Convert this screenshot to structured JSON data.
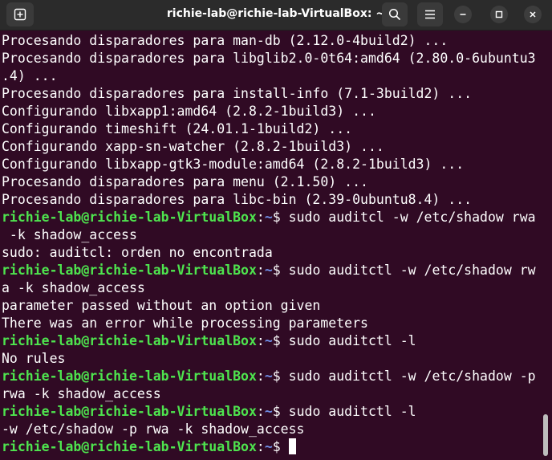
{
  "window": {
    "title": "richie-lab@richie-lab-VirtualBox: ~"
  },
  "icons": {
    "new_tab": "new-tab-icon",
    "search": "search-icon",
    "menu": "hamburger-menu-icon",
    "minimize": "minimize-icon",
    "maximize": "maximize-icon",
    "close": "close-icon"
  },
  "colors": {
    "background": "#300a24",
    "prompt_user": "#4ee44e",
    "prompt_dir": "#6f8fe8",
    "text": "#ffffff"
  },
  "prompt": {
    "user_host": "richie-lab@richie-lab-VirtualBox",
    "sep": ":",
    "dir": "~",
    "dollar": "$ "
  },
  "lines": [
    {
      "type": "out",
      "text": "Procesando disparadores para man-db (2.12.0-4build2) ..."
    },
    {
      "type": "out",
      "text": "Procesando disparadores para libglib2.0-0t64:amd64 (2.80.0-6ubuntu3"
    },
    {
      "type": "out",
      "text": ".4) ..."
    },
    {
      "type": "out",
      "text": "Procesando disparadores para install-info (7.1-3build2) ..."
    },
    {
      "type": "out",
      "text": "Configurando libxapp1:amd64 (2.8.2-1build3) ..."
    },
    {
      "type": "out",
      "text": "Configurando timeshift (24.01.1-1build2) ..."
    },
    {
      "type": "out",
      "text": "Configurando xapp-sn-watcher (2.8.2-1build3) ..."
    },
    {
      "type": "out",
      "text": "Configurando libxapp-gtk3-module:amd64 (2.8.2-1build3) ..."
    },
    {
      "type": "out",
      "text": "Procesando disparadores para menu (2.1.50) ..."
    },
    {
      "type": "out",
      "text": "Procesando disparadores para libc-bin (2.39-0ubuntu8.4) ..."
    },
    {
      "type": "cmd",
      "text": "sudo auditcl -w /etc/shadow rwa"
    },
    {
      "type": "out",
      "text": " -k shadow_access"
    },
    {
      "type": "out",
      "text": "sudo: auditcl: orden no encontrada"
    },
    {
      "type": "cmd",
      "text": "sudo auditctl -w /etc/shadow rw"
    },
    {
      "type": "out",
      "text": "a -k shadow_access"
    },
    {
      "type": "out",
      "text": "parameter passed without an option given"
    },
    {
      "type": "out",
      "text": "There was an error while processing parameters"
    },
    {
      "type": "cmd",
      "text": "sudo auditctl -l"
    },
    {
      "type": "out",
      "text": "No rules"
    },
    {
      "type": "cmd",
      "text": "sudo auditctl -w /etc/shadow -p"
    },
    {
      "type": "out",
      "text": "rwa -k shadow_access"
    },
    {
      "type": "cmd",
      "text": "sudo auditctl -l"
    },
    {
      "type": "out",
      "text": "-w /etc/shadow -p rwa -k shadow_access"
    },
    {
      "type": "cmd",
      "text": ""
    }
  ]
}
